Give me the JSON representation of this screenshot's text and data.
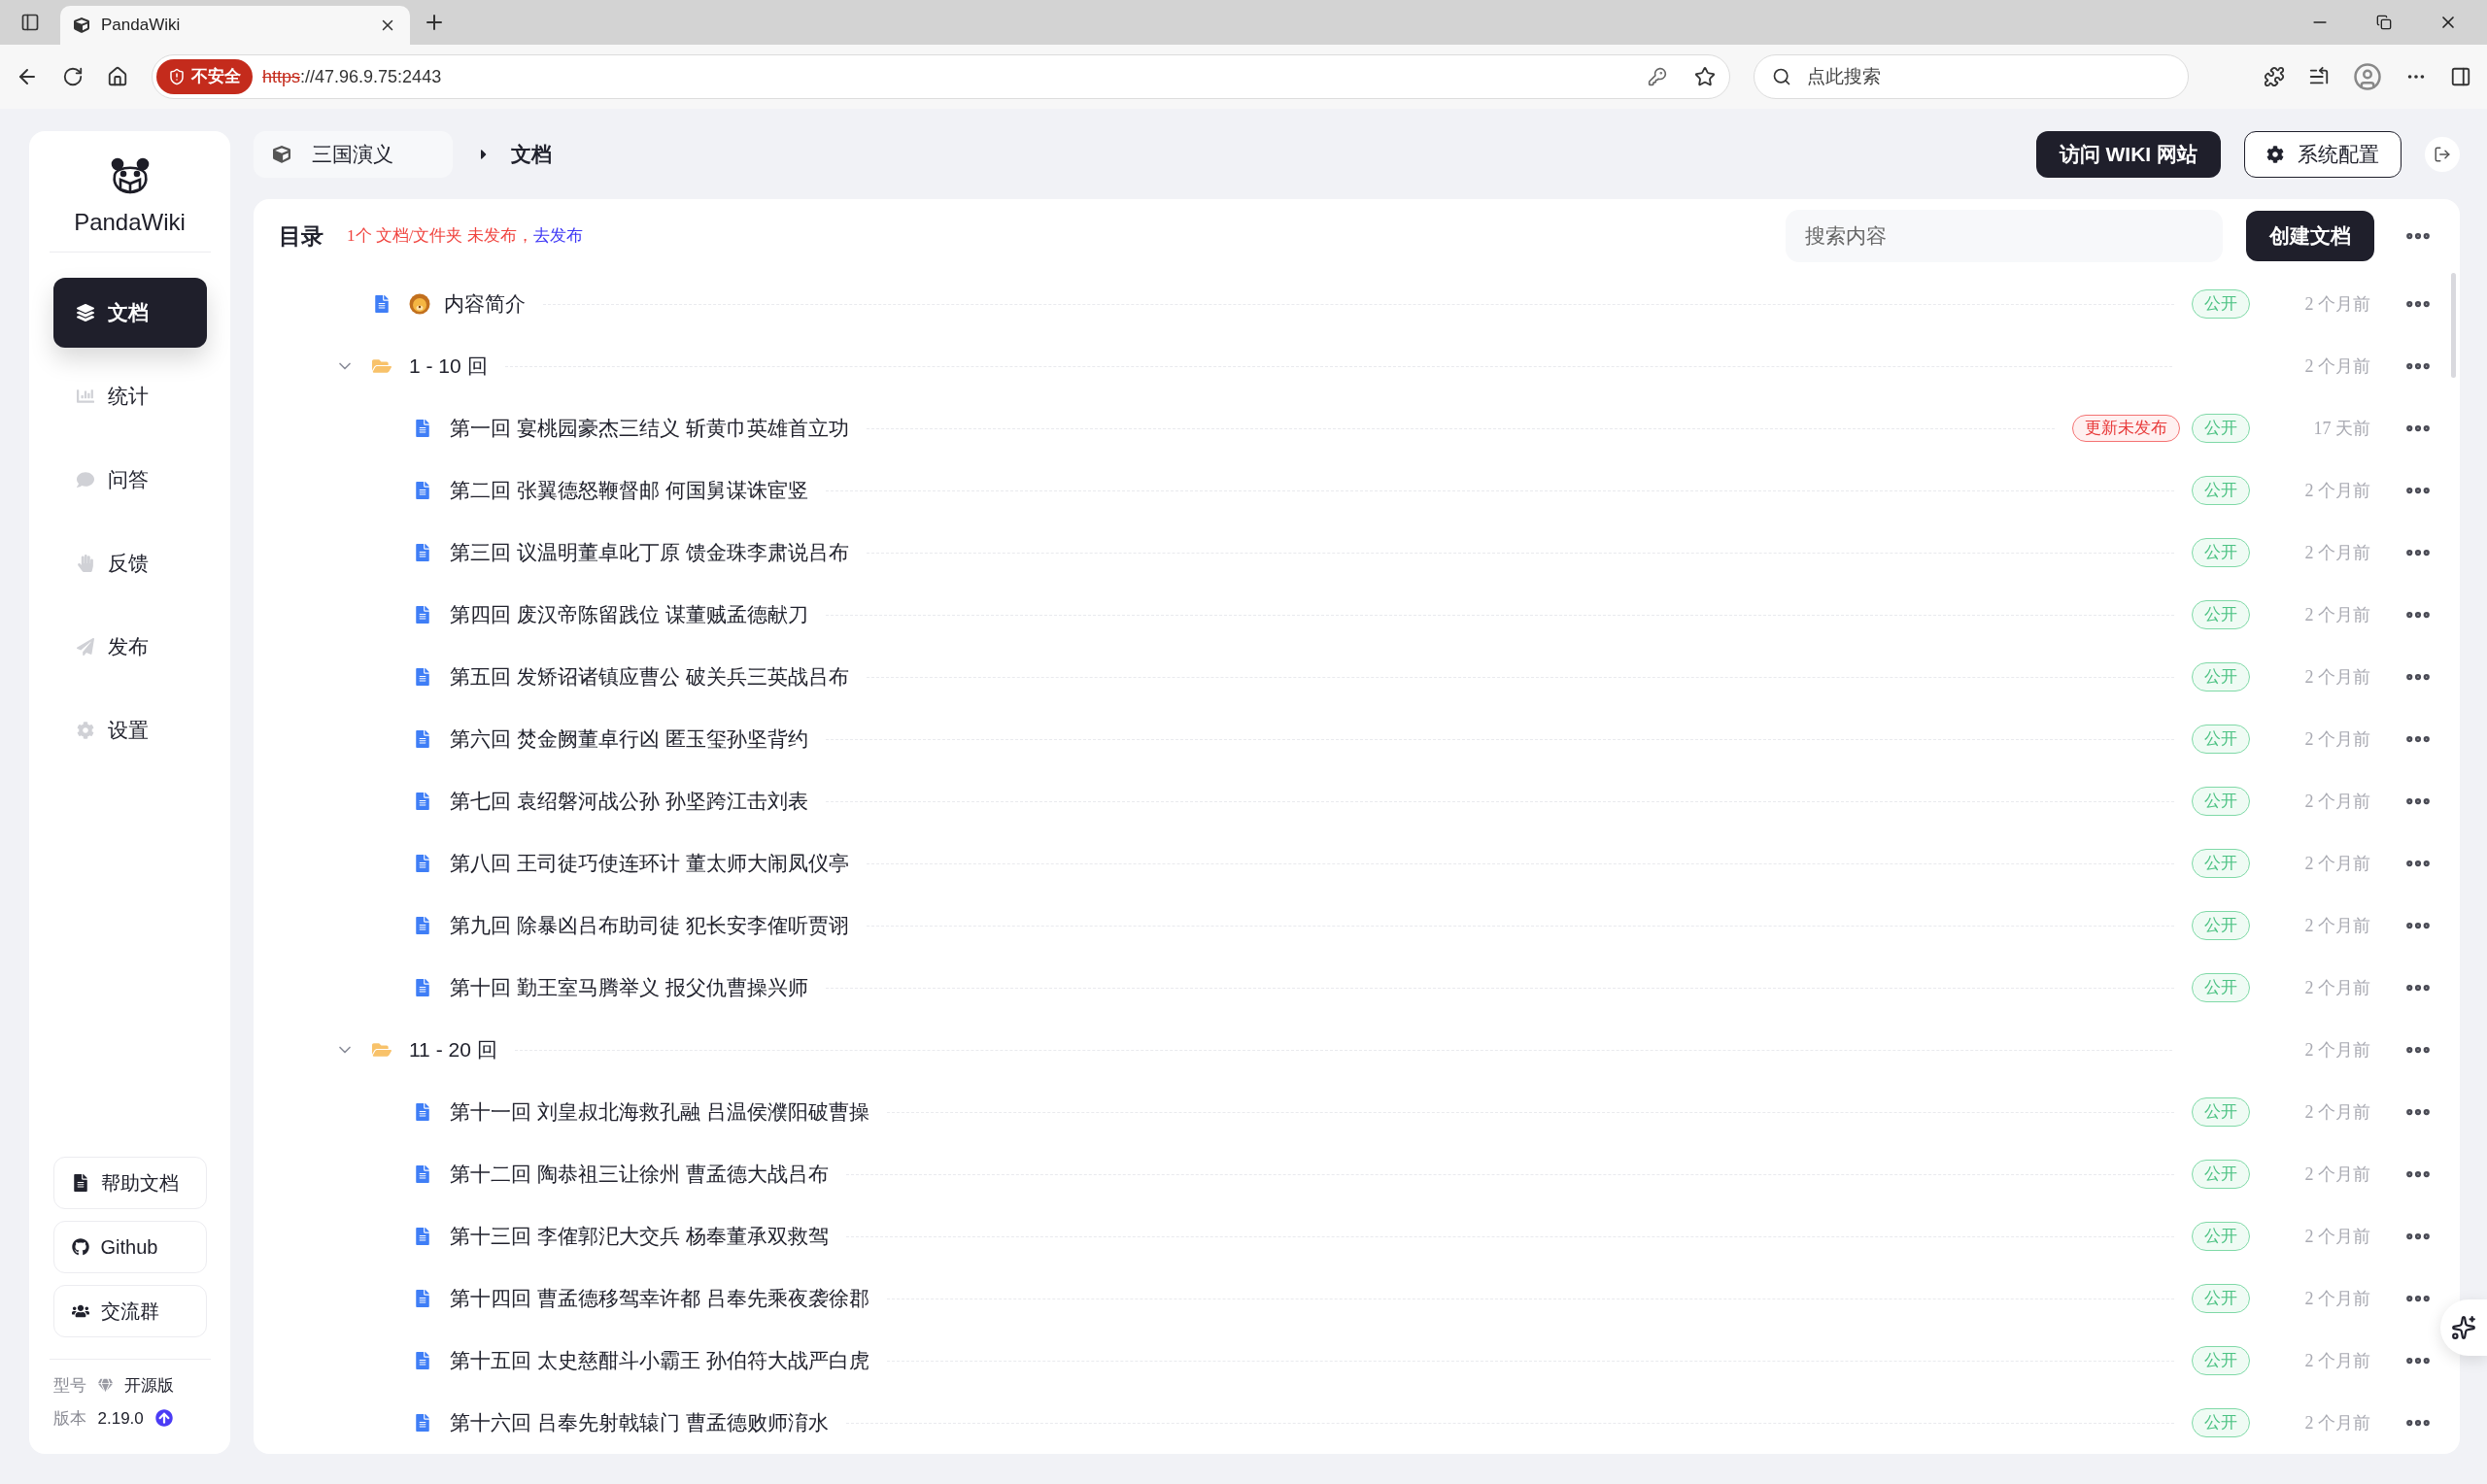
{
  "browser": {
    "tab_title": "PandaWiki",
    "security_label": "不安全",
    "url_scheme": "https",
    "url_rest": "://47.96.9.75:2443",
    "search_placeholder": "点此搜索"
  },
  "sidebar": {
    "brand": "PandaWiki",
    "items": [
      {
        "label": "文档",
        "selected": true
      },
      {
        "label": "统计",
        "selected": false
      },
      {
        "label": "问答",
        "selected": false
      },
      {
        "label": "反馈",
        "selected": false
      },
      {
        "label": "发布",
        "selected": false
      },
      {
        "label": "设置",
        "selected": false
      }
    ],
    "links": [
      {
        "label": "帮助文档"
      },
      {
        "label": "Github"
      },
      {
        "label": "交流群"
      }
    ],
    "edition_label": "型号",
    "edition": "开源版",
    "version_label": "版本",
    "version": "2.19.0"
  },
  "breadcrumb": {
    "space": "三国演义",
    "current": "文档"
  },
  "header_buttons": {
    "visit": "访问 WIKI 网站",
    "settings": "系统配置"
  },
  "catalog": {
    "title": "目录",
    "notice": "1个 文档/文件夹 未发布，",
    "notice_link": "去发布",
    "search_placeholder": "搜索内容",
    "create_button": "创建文档",
    "items": [
      {
        "kind": "emojidoc",
        "title": "内容简介",
        "public": "公开",
        "time": "2 个月前"
      },
      {
        "kind": "folder",
        "title": "1 - 10 回",
        "expanded": true,
        "time": "2 个月前",
        "children": [
          {
            "kind": "doc",
            "title": "第一回 宴桃园豪杰三结义 斩黄巾英雄首立功",
            "unpublished": "更新未发布",
            "public": "公开",
            "time": "17 天前"
          },
          {
            "kind": "doc",
            "title": "第二回 张翼德怒鞭督邮 何国舅谋诛宦竖",
            "public": "公开",
            "time": "2 个月前"
          },
          {
            "kind": "doc",
            "title": "第三回 议温明董卓叱丁原 馈金珠李肃说吕布",
            "public": "公开",
            "time": "2 个月前"
          },
          {
            "kind": "doc",
            "title": "第四回 废汉帝陈留践位 谋董贼孟德献刀",
            "public": "公开",
            "time": "2 个月前"
          },
          {
            "kind": "doc",
            "title": "第五回 发矫诏诸镇应曹公 破关兵三英战吕布",
            "public": "公开",
            "time": "2 个月前"
          },
          {
            "kind": "doc",
            "title": "第六回 焚金阙董卓行凶 匿玉玺孙坚背约",
            "public": "公开",
            "time": "2 个月前"
          },
          {
            "kind": "doc",
            "title": "第七回 袁绍磐河战公孙 孙坚跨江击刘表",
            "public": "公开",
            "time": "2 个月前"
          },
          {
            "kind": "doc",
            "title": "第八回 王司徒巧使连环计 董太师大闹凤仪亭",
            "public": "公开",
            "time": "2 个月前"
          },
          {
            "kind": "doc",
            "title": "第九回 除暴凶吕布助司徒 犯长安李傕听贾诩",
            "public": "公开",
            "time": "2 个月前"
          },
          {
            "kind": "doc",
            "title": "第十回 勤王室马腾举义 报父仇曹操兴师",
            "public": "公开",
            "time": "2 个月前"
          }
        ]
      },
      {
        "kind": "folder",
        "title": "11 - 20 回",
        "expanded": true,
        "time": "2 个月前",
        "children": [
          {
            "kind": "doc",
            "title": "第十一回 刘皇叔北海救孔融 吕温侯濮阳破曹操",
            "public": "公开",
            "time": "2 个月前"
          },
          {
            "kind": "doc",
            "title": "第十二回 陶恭祖三让徐州 曹孟德大战吕布",
            "public": "公开",
            "time": "2 个月前"
          },
          {
            "kind": "doc",
            "title": "第十三回 李傕郭汜大交兵 杨奉董承双救驾",
            "public": "公开",
            "time": "2 个月前"
          },
          {
            "kind": "doc",
            "title": "第十四回 曹孟德移驾幸许都 吕奉先乘夜袭徐郡",
            "public": "公开",
            "time": "2 个月前"
          },
          {
            "kind": "doc",
            "title": "第十五回 太史慈酣斗小霸王 孙伯符大战严白虎",
            "public": "公开",
            "time": "2 个月前"
          },
          {
            "kind": "doc",
            "title": "第十六回 吕奉先射戟辕门 曹孟德败师淯水",
            "public": "公开",
            "time": "2 个月前"
          }
        ]
      }
    ]
  }
}
